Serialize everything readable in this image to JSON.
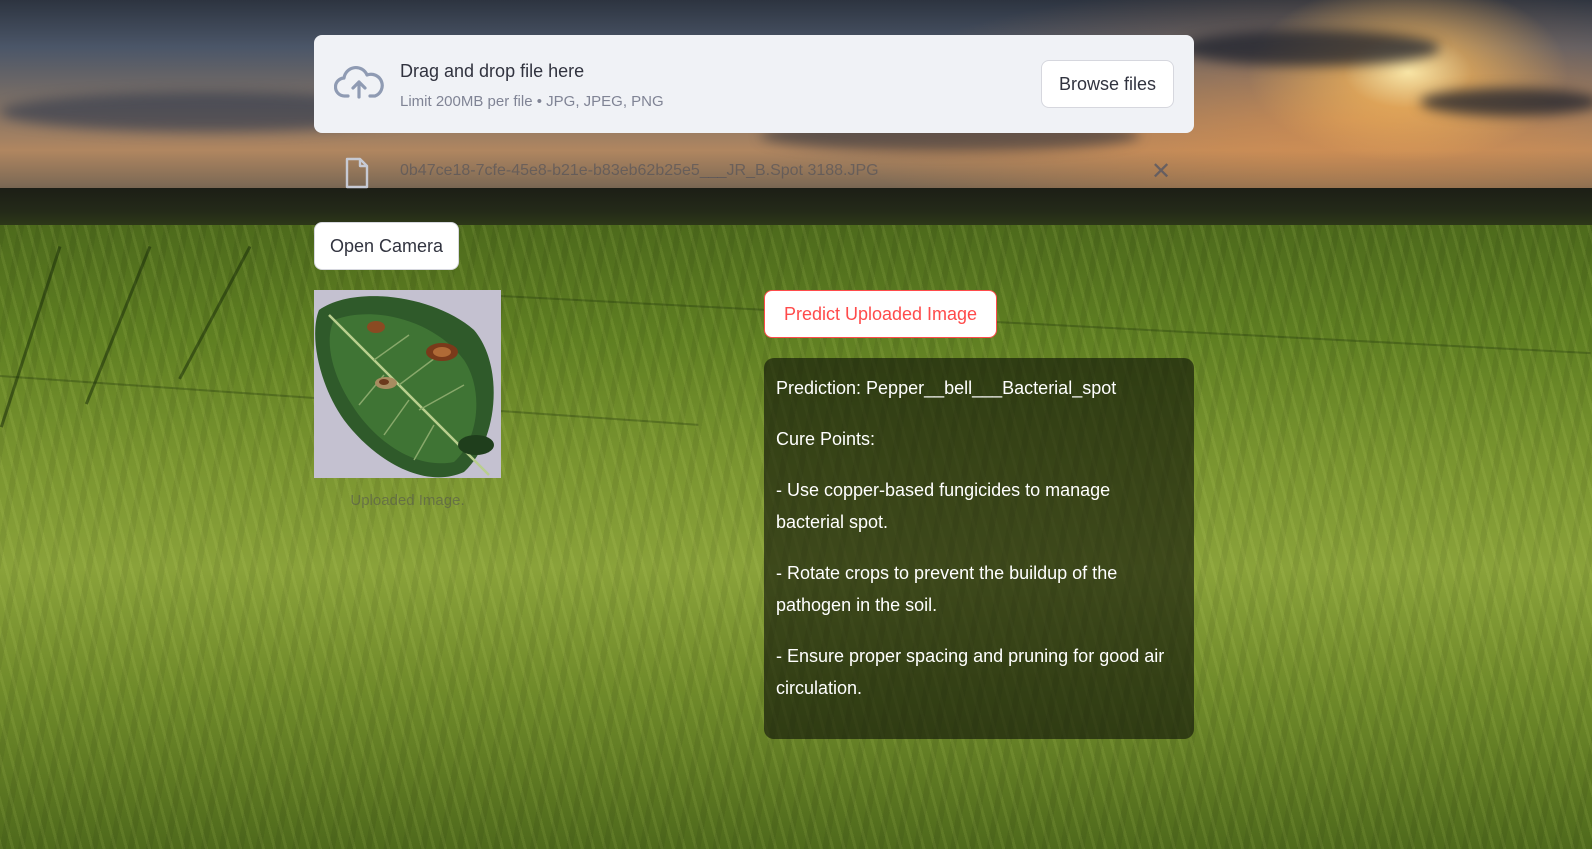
{
  "uploader": {
    "title": "Drag and drop file here",
    "limit": "Limit 200MB per file • JPG, JPEG, PNG",
    "browse_label": "Browse files",
    "icon": "cloud-upload-icon"
  },
  "uploaded_file": {
    "name": "0b47ce18-7cfe-45e8-b21e-b83eb62b25e5___JR_B.Spot 3188.JPG",
    "icon": "file-icon",
    "remove_symbol": "✕"
  },
  "camera": {
    "label": "Open Camera"
  },
  "image_preview": {
    "caption": "Uploaded Image."
  },
  "predict": {
    "label": "Predict Uploaded Image",
    "accent": "#ff4b4b"
  },
  "result": {
    "prediction": "Prediction: Pepper__bell___Bacterial_spot",
    "cure_heading": "Cure Points:",
    "points": [
      "- Use copper-based fungicides to manage bacterial spot.",
      "- Rotate crops to prevent the buildup of the pathogen in the soil.",
      "- Ensure proper spacing and pruning for good air circulation."
    ]
  }
}
